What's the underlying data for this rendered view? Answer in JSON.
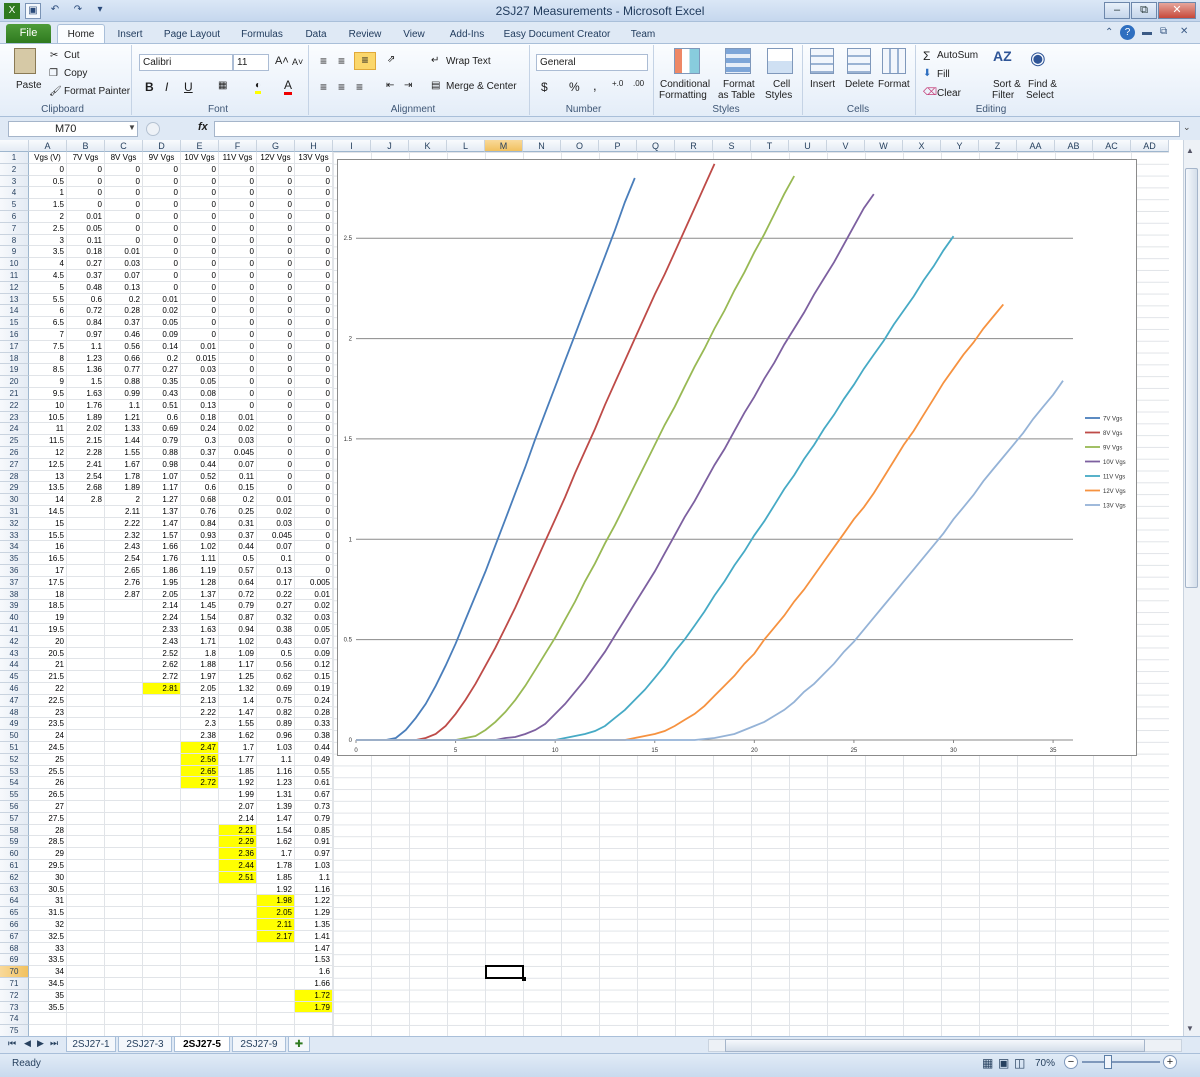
{
  "window": {
    "title": "2SJ27 Measurements  -  Microsoft Excel",
    "minimize": "–",
    "restore": "⧉",
    "close": "✕",
    "ribbon_close": "✕",
    "help": "?"
  },
  "tabs": [
    "File",
    "Home",
    "Insert",
    "Page Layout",
    "Formulas",
    "Data",
    "Review",
    "View",
    "Add-Ins",
    "Easy Document Creator",
    "Team"
  ],
  "ribbon": {
    "paste": "Paste",
    "cut": "Cut",
    "copy": "Copy",
    "format_painter": "Format Painter",
    "clipboard": "Clipboard",
    "font_name": "Calibri",
    "font_size": "11",
    "bold": "B",
    "italic": "I",
    "underline": "U",
    "font_group": "Font",
    "wrap_text": "Wrap Text",
    "merge_center": "Merge & Center",
    "alignment": "Alignment",
    "number_format": "General",
    "currency": "$",
    "percent": "%",
    "comma": ",",
    "inc_dec": "+.0",
    "dec_dec": ".00",
    "number_group": "Number",
    "conditional_1": "Conditional",
    "conditional_2": "Formatting",
    "format_table_1": "Format",
    "format_table_2": "as Table",
    "cell_styles_1": "Cell",
    "cell_styles_2": "Styles",
    "styles_group": "Styles",
    "insert": "Insert",
    "delete": "Delete",
    "format": "Format",
    "cells_group": "Cells",
    "autosum": "AutoSum",
    "fill": "Fill",
    "clear": "Clear",
    "sort_1": "Sort &",
    "sort_2": "Filter",
    "find_1": "Find &",
    "find_2": "Select",
    "editing_group": "Editing",
    "font_grow": "A˄",
    "font_shrink": "A˅"
  },
  "formula_bar": {
    "name_box": "M70",
    "fx": "fx",
    "formula": ""
  },
  "columns": [
    "A",
    "B",
    "C",
    "D",
    "E",
    "F",
    "G",
    "H",
    "I",
    "J",
    "K",
    "L",
    "M",
    "N",
    "O",
    "P",
    "Q",
    "R",
    "S",
    "T",
    "U",
    "V",
    "W",
    "X",
    "Y",
    "Z",
    "AA",
    "AB",
    "AC",
    "AD"
  ],
  "rows": {
    "start": 1,
    "end": 75
  },
  "headers": [
    "Vgs (V)",
    "7V Vgs",
    "8V Vgs",
    "9V Vgs",
    "10V Vgs",
    "11V Vgs",
    "12V Vgs",
    "13V Vgs"
  ],
  "sheet": [
    [
      "0",
      "0",
      "0",
      "0",
      "0",
      "0",
      "0",
      "0"
    ],
    [
      "0.5",
      "0",
      "0",
      "0",
      "0",
      "0",
      "0",
      "0"
    ],
    [
      "1",
      "0",
      "0",
      "0",
      "0",
      "0",
      "0",
      "0"
    ],
    [
      "1.5",
      "0",
      "0",
      "0",
      "0",
      "0",
      "0",
      "0"
    ],
    [
      "2",
      "0.01",
      "0",
      "0",
      "0",
      "0",
      "0",
      "0"
    ],
    [
      "2.5",
      "0.05",
      "0",
      "0",
      "0",
      "0",
      "0",
      "0"
    ],
    [
      "3",
      "0.11",
      "0",
      "0",
      "0",
      "0",
      "0",
      "0"
    ],
    [
      "3.5",
      "0.18",
      "0.01",
      "0",
      "0",
      "0",
      "0",
      "0"
    ],
    [
      "4",
      "0.27",
      "0.03",
      "0",
      "0",
      "0",
      "0",
      "0"
    ],
    [
      "4.5",
      "0.37",
      "0.07",
      "0",
      "0",
      "0",
      "0",
      "0"
    ],
    [
      "5",
      "0.48",
      "0.13",
      "0",
      "0",
      "0",
      "0",
      "0"
    ],
    [
      "5.5",
      "0.6",
      "0.2",
      "0.01",
      "0",
      "0",
      "0",
      "0"
    ],
    [
      "6",
      "0.72",
      "0.28",
      "0.02",
      "0",
      "0",
      "0",
      "0"
    ],
    [
      "6.5",
      "0.84",
      "0.37",
      "0.05",
      "0",
      "0",
      "0",
      "0"
    ],
    [
      "7",
      "0.97",
      "0.46",
      "0.09",
      "0",
      "0",
      "0",
      "0"
    ],
    [
      "7.5",
      "1.1",
      "0.56",
      "0.14",
      "0.01",
      "0",
      "0",
      "0"
    ],
    [
      "8",
      "1.23",
      "0.66",
      "0.2",
      "0.015",
      "0",
      "0",
      "0"
    ],
    [
      "8.5",
      "1.36",
      "0.77",
      "0.27",
      "0.03",
      "0",
      "0",
      "0"
    ],
    [
      "9",
      "1.5",
      "0.88",
      "0.35",
      "0.05",
      "0",
      "0",
      "0"
    ],
    [
      "9.5",
      "1.63",
      "0.99",
      "0.43",
      "0.08",
      "0",
      "0",
      "0"
    ],
    [
      "10",
      "1.76",
      "1.1",
      "0.51",
      "0.13",
      "0",
      "0",
      "0"
    ],
    [
      "10.5",
      "1.89",
      "1.21",
      "0.6",
      "0.18",
      "0.01",
      "0",
      "0"
    ],
    [
      "11",
      "2.02",
      "1.33",
      "0.69",
      "0.24",
      "0.02",
      "0",
      "0"
    ],
    [
      "11.5",
      "2.15",
      "1.44",
      "0.79",
      "0.3",
      "0.03",
      "0",
      "0"
    ],
    [
      "12",
      "2.28",
      "1.55",
      "0.88",
      "0.37",
      "0.045",
      "0",
      "0"
    ],
    [
      "12.5",
      "2.41",
      "1.67",
      "0.98",
      "0.44",
      "0.07",
      "0",
      "0"
    ],
    [
      "13",
      "2.54",
      "1.78",
      "1.07",
      "0.52",
      "0.11",
      "0",
      "0"
    ],
    [
      "13.5",
      "2.68",
      "1.89",
      "1.17",
      "0.6",
      "0.15",
      "0",
      "0"
    ],
    [
      "14",
      "2.8",
      "2",
      "1.27",
      "0.68",
      "0.2",
      "0.01",
      "0"
    ],
    [
      "14.5",
      "",
      "2.11",
      "1.37",
      "0.76",
      "0.25",
      "0.02",
      "0"
    ],
    [
      "15",
      "",
      "2.22",
      "1.47",
      "0.84",
      "0.31",
      "0.03",
      "0"
    ],
    [
      "15.5",
      "",
      "2.32",
      "1.57",
      "0.93",
      "0.37",
      "0.045",
      "0"
    ],
    [
      "16",
      "",
      "2.43",
      "1.66",
      "1.02",
      "0.44",
      "0.07",
      "0"
    ],
    [
      "16.5",
      "",
      "2.54",
      "1.76",
      "1.11",
      "0.5",
      "0.1",
      "0"
    ],
    [
      "17",
      "",
      "2.65",
      "1.86",
      "1.19",
      "0.57",
      "0.13",
      "0"
    ],
    [
      "17.5",
      "",
      "2.76",
      "1.95",
      "1.28",
      "0.64",
      "0.17",
      "0.005"
    ],
    [
      "18",
      "",
      "2.87",
      "2.05",
      "1.37",
      "0.72",
      "0.22",
      "0.01"
    ],
    [
      "18.5",
      "",
      "",
      "2.14",
      "1.45",
      "0.79",
      "0.27",
      "0.02"
    ],
    [
      "19",
      "",
      "",
      "2.24",
      "1.54",
      "0.87",
      "0.32",
      "0.03"
    ],
    [
      "19.5",
      "",
      "",
      "2.33",
      "1.63",
      "0.94",
      "0.38",
      "0.05"
    ],
    [
      "20",
      "",
      "",
      "2.43",
      "1.71",
      "1.02",
      "0.43",
      "0.07"
    ],
    [
      "20.5",
      "",
      "",
      "2.52",
      "1.8",
      "1.09",
      "0.5",
      "0.09"
    ],
    [
      "21",
      "",
      "",
      "2.62",
      "1.88",
      "1.17",
      "0.56",
      "0.12"
    ],
    [
      "21.5",
      "",
      "",
      "2.72",
      "1.97",
      "1.25",
      "0.62",
      "0.15"
    ],
    [
      "22",
      "",
      "",
      "2.81",
      "2.05",
      "1.32",
      "0.69",
      "0.19"
    ],
    [
      "22.5",
      "",
      "",
      "",
      "2.13",
      "1.4",
      "0.75",
      "0.24"
    ],
    [
      "23",
      "",
      "",
      "",
      "2.22",
      "1.47",
      "0.82",
      "0.28"
    ],
    [
      "23.5",
      "",
      "",
      "",
      "2.3",
      "1.55",
      "0.89",
      "0.33"
    ],
    [
      "24",
      "",
      "",
      "",
      "2.38",
      "1.62",
      "0.96",
      "0.38"
    ],
    [
      "24.5",
      "",
      "",
      "",
      "2.47",
      "1.7",
      "1.03",
      "0.44"
    ],
    [
      "25",
      "",
      "",
      "",
      "2.56",
      "1.77",
      "1.1",
      "0.49"
    ],
    [
      "25.5",
      "",
      "",
      "",
      "2.65",
      "1.85",
      "1.16",
      "0.55"
    ],
    [
      "26",
      "",
      "",
      "",
      "2.72",
      "1.92",
      "1.23",
      "0.61"
    ],
    [
      "26.5",
      "",
      "",
      "",
      "",
      "1.99",
      "1.31",
      "0.67"
    ],
    [
      "27",
      "",
      "",
      "",
      "",
      "2.07",
      "1.39",
      "0.73"
    ],
    [
      "27.5",
      "",
      "",
      "",
      "",
      "2.14",
      "1.47",
      "0.79"
    ],
    [
      "28",
      "",
      "",
      "",
      "",
      "2.21",
      "1.54",
      "0.85"
    ],
    [
      "28.5",
      "",
      "",
      "",
      "",
      "2.29",
      "1.62",
      "0.91"
    ],
    [
      "29",
      "",
      "",
      "",
      "",
      "2.36",
      "1.7",
      "0.97"
    ],
    [
      "29.5",
      "",
      "",
      "",
      "",
      "2.44",
      "1.78",
      "1.03"
    ],
    [
      "30",
      "",
      "",
      "",
      "",
      "2.51",
      "1.85",
      "1.1"
    ],
    [
      "30.5",
      "",
      "",
      "",
      "",
      "",
      "1.92",
      "1.16"
    ],
    [
      "31",
      "",
      "",
      "",
      "",
      "",
      "1.98",
      "1.22"
    ],
    [
      "31.5",
      "",
      "",
      "",
      "",
      "",
      "2.05",
      "1.29"
    ],
    [
      "32",
      "",
      "",
      "",
      "",
      "",
      "2.11",
      "1.35"
    ],
    [
      "32.5",
      "",
      "",
      "",
      "",
      "",
      "2.17",
      "1.41"
    ],
    [
      "33",
      "",
      "",
      "",
      "",
      "",
      "",
      "1.47"
    ],
    [
      "33.5",
      "",
      "",
      "",
      "",
      "",
      "",
      "1.53"
    ],
    [
      "34",
      "",
      "",
      "",
      "",
      "",
      "",
      "1.6"
    ],
    [
      "34.5",
      "",
      "",
      "",
      "",
      "",
      "",
      "1.66"
    ],
    [
      "35",
      "",
      "",
      "",
      "",
      "",
      "",
      "1.72"
    ],
    [
      "35.5",
      "",
      "",
      "",
      "",
      "",
      "",
      "1.79"
    ]
  ],
  "highlights": [
    [
      46,
      3
    ],
    [
      51,
      4
    ],
    [
      52,
      4
    ],
    [
      53,
      4
    ],
    [
      54,
      4
    ],
    [
      58,
      5
    ],
    [
      59,
      5
    ],
    [
      60,
      5
    ],
    [
      61,
      5
    ],
    [
      62,
      5
    ],
    [
      64,
      6
    ],
    [
      65,
      6
    ],
    [
      66,
      6
    ],
    [
      67,
      6
    ],
    [
      72,
      7
    ],
    [
      73,
      7
    ]
  ],
  "selected": {
    "row": 70,
    "col": 12
  },
  "chart_data": {
    "type": "line",
    "title": "",
    "xlabel": "",
    "ylabel": "",
    "xlim": [
      0,
      36
    ],
    "ylim": [
      0,
      2.8
    ],
    "xticks": [
      0,
      5,
      10,
      15,
      20,
      25,
      30,
      35
    ],
    "yticks": [
      0,
      0.5,
      1,
      1.5,
      2,
      2.5
    ],
    "ygrid": true,
    "legend": "right",
    "series": [
      {
        "name": "7V Vgs",
        "color": "#4a7ebb"
      },
      {
        "name": "8V Vgs",
        "color": "#be4b48"
      },
      {
        "name": "9V Vgs",
        "color": "#98b954"
      },
      {
        "name": "10V Vgs",
        "color": "#7d60a0"
      },
      {
        "name": "11V Vgs",
        "color": "#46aac5"
      },
      {
        "name": "12V Vgs",
        "color": "#f69240"
      },
      {
        "name": "13V Vgs",
        "color": "#95b3d7"
      }
    ]
  },
  "sheet_tabs": [
    "2SJ27-1",
    "2SJ27-3",
    "2SJ27-5",
    "2SJ27-9"
  ],
  "active_sheet": "2SJ27-5",
  "status": {
    "ready": "Ready",
    "zoom": "70%",
    "zoom_out": "−",
    "zoom_in": "+"
  }
}
